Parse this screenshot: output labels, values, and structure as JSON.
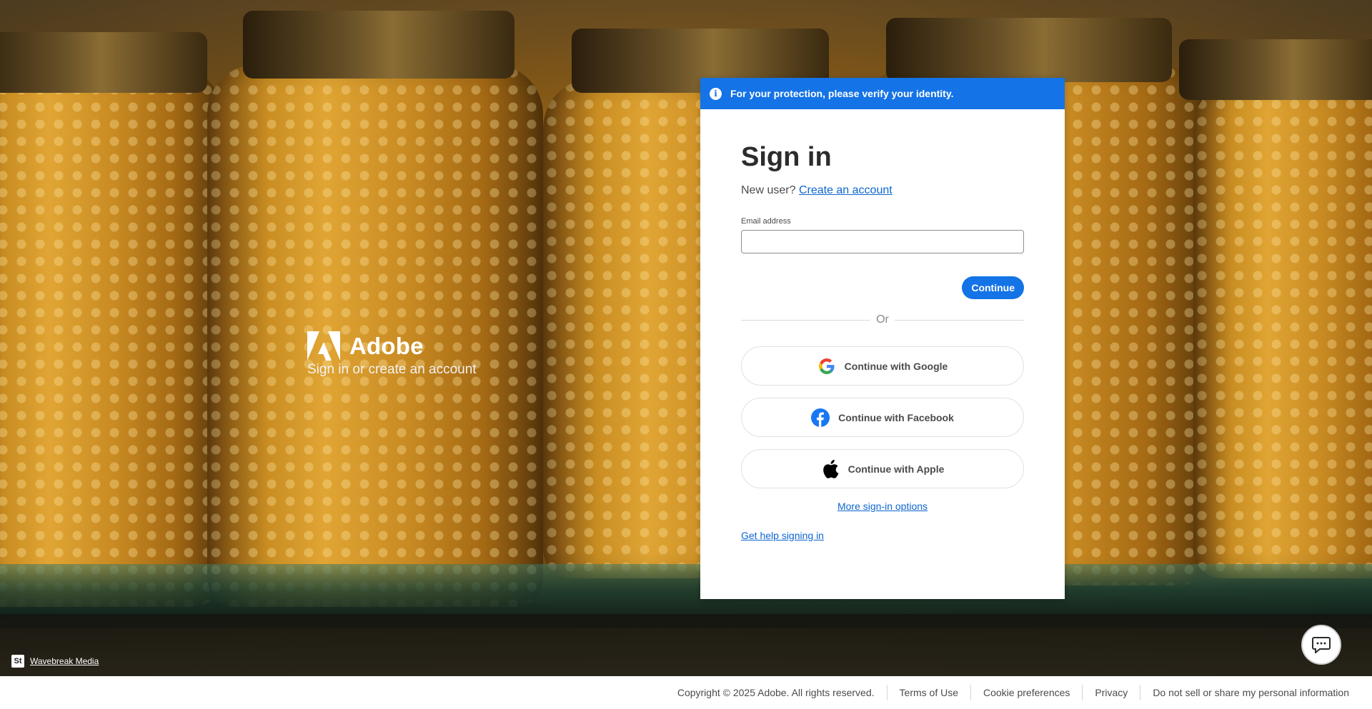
{
  "brand": {
    "name": "Adobe",
    "tagline": "Sign in or create an account"
  },
  "alert": {
    "text": "For your protection, please verify your identity."
  },
  "signin": {
    "title": "Sign in",
    "new_user_text": "New user?",
    "create_account_link": "Create an account",
    "email_label": "Email address",
    "email_value": "",
    "continue_label": "Continue",
    "or_label": "Or",
    "google_label": "Continue with Google",
    "facebook_label": "Continue with Facebook",
    "apple_label": "Continue with Apple",
    "more_options_link": "More sign-in options",
    "help_link": "Get help signing in"
  },
  "credit": {
    "badge": "St",
    "author": "Wavebreak Media"
  },
  "footer": {
    "copyright": "Copyright © 2025 Adobe. All rights reserved.",
    "terms": "Terms of Use",
    "cookies": "Cookie preferences",
    "privacy": "Privacy",
    "do_not_sell": "Do not sell or share my personal information"
  },
  "colors": {
    "accent": "#1473e6",
    "link": "#0d66d0",
    "facebook": "#1877f2"
  },
  "icons": [
    "info-icon",
    "adobe-logo-icon",
    "google-icon",
    "facebook-icon",
    "apple-icon",
    "stock-icon",
    "chat-icon"
  ]
}
